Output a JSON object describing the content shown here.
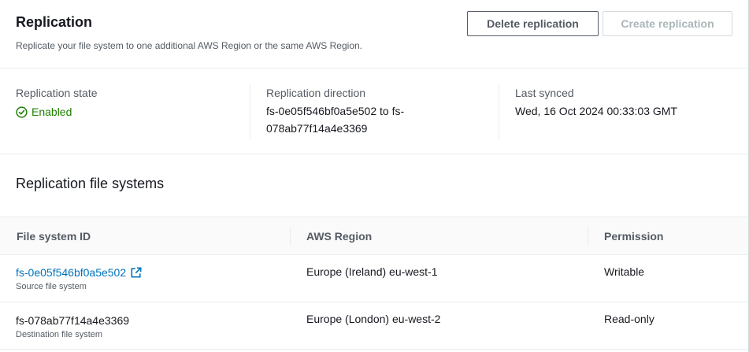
{
  "header": {
    "title": "Replication",
    "description": "Replicate your file system to one additional AWS Region or the same AWS Region.",
    "delete_button": "Delete replication",
    "create_button": "Create replication"
  },
  "summary": {
    "state_label": "Replication state",
    "state_value": "Enabled",
    "direction_label": "Replication direction",
    "direction_line1": "fs-0e05f546bf0a5e502 to fs-",
    "direction_line2": "078ab77f14a4e3369",
    "synced_label": "Last synced",
    "synced_value": "Wed, 16 Oct 2024 00:33:03 GMT"
  },
  "file_systems": {
    "title": "Replication file systems",
    "columns": [
      "File system ID",
      "AWS Region",
      "Permission"
    ],
    "rows": [
      {
        "id": "fs-0e05f546bf0a5e502",
        "role": "Source file system",
        "region": "Europe (Ireland) eu-west-1",
        "permission": "Writable"
      },
      {
        "id": "fs-078ab77f14a4e3369",
        "role": "Destination file system",
        "region": "Europe (London) eu-west-2",
        "permission": "Read-only"
      }
    ]
  },
  "colors": {
    "link": "#0073bb",
    "success": "#1d8102",
    "text": "#16191f",
    "muted": "#545b64",
    "border": "#eaeded"
  },
  "icons": {
    "status": "check-circle-icon",
    "external": "external-link-icon"
  }
}
